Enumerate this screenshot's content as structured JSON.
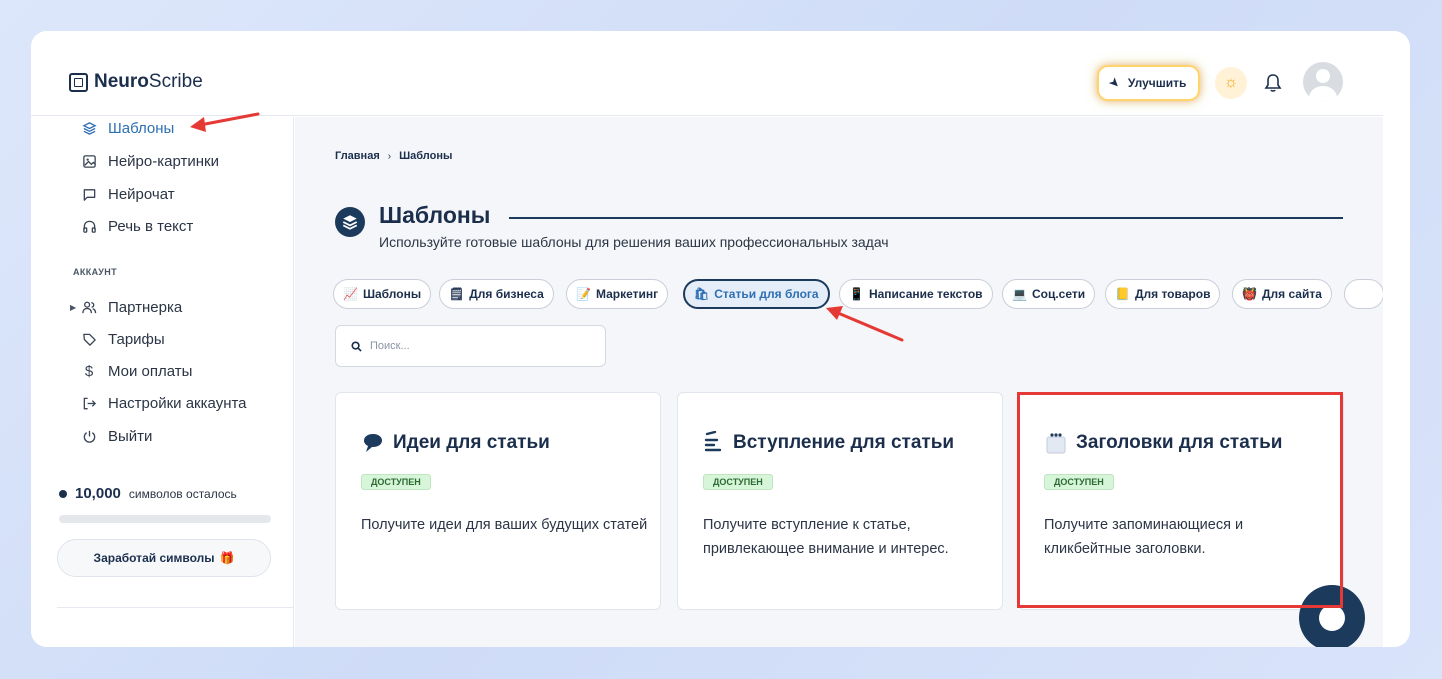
{
  "brand": {
    "name_bold": "Neuro",
    "name_light": "Scribe"
  },
  "header": {
    "upgrade_label": "Улучшить"
  },
  "sidebar": {
    "items": [
      {
        "label": "Шаблоны",
        "icon": "layers-icon"
      },
      {
        "label": "Нейро-картинки",
        "icon": "image-icon"
      },
      {
        "label": "Нейрочат",
        "icon": "chat-icon"
      },
      {
        "label": "Речь в текст",
        "icon": "headphones-icon"
      }
    ],
    "section_label": "АККАУНТ",
    "account_items": [
      {
        "label": "Партнерка",
        "icon": "users-icon"
      },
      {
        "label": "Тарифы",
        "icon": "tag-icon"
      },
      {
        "label": "Мои оплаты",
        "icon": "dollar-icon"
      },
      {
        "label": "Настройки аккаунта",
        "icon": "logout-icon"
      },
      {
        "label": "Выйти",
        "icon": "power-icon"
      }
    ],
    "credits": {
      "amount": "10,000",
      "label": "символов осталось"
    },
    "earn_button": "Заработай символы"
  },
  "main": {
    "breadcrumb": {
      "home": "Главная",
      "current": "Шаблоны"
    },
    "title": "Шаблоны",
    "subtitle": "Используйте готовые шаблоны для решения ваших профессиональных задач",
    "chips": [
      {
        "label": "Шаблоны",
        "icon": "📈"
      },
      {
        "label": "Для бизнеса",
        "icon": "🗒"
      },
      {
        "label": "Маркетинг",
        "icon": "📝"
      },
      {
        "label": "Статьи для блога",
        "icon": "🛍"
      },
      {
        "label": "Написание текстов",
        "icon": "📱"
      },
      {
        "label": "Соц.сети",
        "icon": "💻"
      },
      {
        "label": "Для товаров",
        "icon": "📒"
      },
      {
        "label": "Для сайта",
        "icon": "👹"
      }
    ],
    "search_placeholder": "Поиск...",
    "cards": [
      {
        "title": "Идеи для статьи",
        "badge": "ДОСТУПЕН",
        "description": "Получите идеи для ваших будущих статей"
      },
      {
        "title": "Вступление для статьи",
        "badge": "ДОСТУПЕН",
        "description": "Получите вступление к статье, привлекающее внимание и интерес."
      },
      {
        "title": "Заголовки для статьи",
        "badge": "ДОСТУПЕН",
        "description": "Получите запоминающиеся и кликбейтные заголовки."
      }
    ]
  },
  "colors": {
    "brand_dark": "#1b3a5c",
    "active_link": "#2d6fb3",
    "badge_bg": "#d7f5d8",
    "annotation_red": "#e53935"
  }
}
